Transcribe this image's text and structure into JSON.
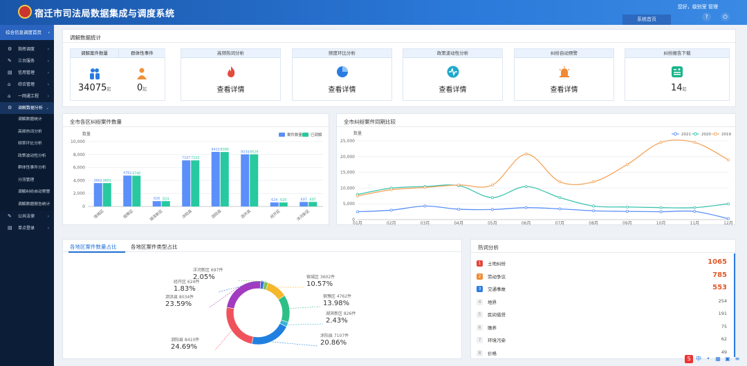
{
  "header": {
    "title": "宿迁市司法局数据集成与调度系统",
    "tab": "系统首页",
    "greeting": "您好，级别室 管理"
  },
  "sidebar": {
    "top": "综合信息调度首页",
    "items": [
      {
        "label": "指挥调度",
        "icon": "⚙"
      },
      {
        "label": "三台服务",
        "icon": "✎"
      },
      {
        "label": "信用管理",
        "icon": "▤"
      },
      {
        "label": "综合管理",
        "icon": "⌂"
      },
      {
        "label": "一网通工程",
        "icon": "⌂"
      },
      {
        "label": "调解数据分析",
        "icon": "⚙"
      }
    ],
    "subitems": [
      "调解数据统计",
      "高频热词分析",
      "频率环比分析",
      "政策波动性分析",
      "群体性事件分析",
      "分流管理",
      "调解纠纷自动预警",
      "调解数据报告统计"
    ],
    "items_after": [
      {
        "label": "公共法律",
        "icon": "✎"
      },
      {
        "label": "单点登录",
        "icon": "▤"
      }
    ]
  },
  "stats": {
    "title": "调解数据统计",
    "case_label": "调解案件数量",
    "case_value": "34075",
    "case_unit": "起",
    "group_label": "群体性事件",
    "group_value": "0",
    "group_unit": "起",
    "cards": [
      {
        "title": "高频热词分析",
        "link": "查看详情",
        "icon": "fire-icon",
        "color": "#e64a3b"
      },
      {
        "title": "频度环比分析",
        "link": "查看详情",
        "icon": "pie-icon",
        "color": "#2a7be0"
      },
      {
        "title": "政策波动性分析",
        "link": "查看详情",
        "icon": "pulse-icon",
        "color": "#1fa9c9"
      },
      {
        "title": "纠纷自动预警",
        "link": "查看详情",
        "icon": "alarm-icon",
        "color": "#f08a35"
      },
      {
        "title": "纠纷报告下载",
        "value": "14",
        "unit": "起",
        "icon": "report-icon",
        "color": "#19b58a"
      }
    ]
  },
  "bar_panel": {
    "title": "全市各区纠纷案件数量"
  },
  "line_panel": {
    "title": "全市纠纷案件同期比较"
  },
  "pie_panel": {
    "tabs": [
      "各地区案件数量占比",
      "各地区案件类型占比"
    ]
  },
  "hot_panel": {
    "title": "热词分析",
    "items": [
      {
        "rank": "1",
        "name": "土地纠纷",
        "count": "1065"
      },
      {
        "rank": "2",
        "name": "劳动争议",
        "count": "785"
      },
      {
        "rank": "3",
        "name": "交通事故",
        "count": "553"
      },
      {
        "rank": "4",
        "name": "地界",
        "count": "254"
      },
      {
        "rank": "5",
        "name": "民间借贷",
        "count": "191"
      },
      {
        "rank": "6",
        "name": "赡养",
        "count": "75"
      },
      {
        "rank": "7",
        "name": "环境污染",
        "count": "62"
      },
      {
        "rank": "8",
        "name": "价格",
        "count": "49"
      }
    ]
  },
  "chart_data": [
    {
      "type": "bar",
      "title": "全市各区纠纷案件数量",
      "ylabel": "数量",
      "ylim": [
        0,
        10000
      ],
      "yticks": [
        "0",
        "2,000",
        "4,000",
        "6,000",
        "8,000",
        "10,000"
      ],
      "legend_position": "top-right",
      "categories": [
        "宿城区",
        "宿豫区",
        "湖滨新区",
        "沭阳县",
        "泗阳县",
        "泗洪县",
        "经开区",
        "洋河新区"
      ],
      "series": [
        {
          "name": "案件数量",
          "color": "#5b8ff9",
          "values": [
            3602,
            4762,
            826,
            7107,
            8410,
            8034,
            624,
            697
          ]
        },
        {
          "name": "已调解",
          "color": "#27c9a0",
          "values": [
            3601,
            4740,
            824,
            7103,
            8390,
            8029,
            620,
            697
          ]
        }
      ]
    },
    {
      "type": "line",
      "title": "全市纠纷案件同期比较",
      "ylabel": "数量",
      "ylim": [
        0,
        25000
      ],
      "yticks": [
        "0",
        "5,000",
        "10,000",
        "15,000",
        "20,000",
        "25,000"
      ],
      "legend_position": "top-right",
      "categories": [
        "01月",
        "02月",
        "03月",
        "04月",
        "05月",
        "06月",
        "07月",
        "08月",
        "09月",
        "10月",
        "11月",
        "12月"
      ],
      "series": [
        {
          "name": "2021",
          "color": "#5b8ff9",
          "values": [
            2500,
            3000,
            4300,
            3300,
            3200,
            3800,
            3400,
            2800,
            2600,
            2500,
            2600,
            300
          ]
        },
        {
          "name": "2020",
          "color": "#3cc4b0",
          "values": [
            8000,
            10000,
            10500,
            10800,
            7000,
            10500,
            7000,
            4300,
            4000,
            3800,
            3800,
            5000
          ]
        },
        {
          "name": "2019",
          "color": "#f5a55b",
          "values": [
            7500,
            9500,
            10200,
            11000,
            11000,
            20800,
            12000,
            12000,
            17500,
            24500,
            24500,
            19000
          ]
        }
      ]
    },
    {
      "type": "pie",
      "title": "",
      "slices": [
        {
          "label": "宿城区",
          "count": "3602件",
          "percent": "10.57%",
          "value": 3602,
          "color": "#f5b72b"
        },
        {
          "label": "宿豫区",
          "count": "4762件",
          "percent": "13.98%",
          "value": 4762,
          "color": "#2fbf86"
        },
        {
          "label": "湖滨新区",
          "count": "826件",
          "percent": "2.43%",
          "value": 826,
          "color": "#3ab5d4"
        },
        {
          "label": "沭阳县",
          "count": "7107件",
          "percent": "20.86%",
          "value": 7107,
          "color": "#2080e0"
        },
        {
          "label": "泗阳县",
          "count": "8410件",
          "percent": "24.69%",
          "value": 8410,
          "color": "#f0525c"
        },
        {
          "label": "泗洪县",
          "count": "8034件",
          "percent": "23.59%",
          "value": 8034,
          "color": "#a23bbf"
        },
        {
          "label": "经开区",
          "count": "624件",
          "percent": "1.83%",
          "value": 624,
          "color": "#3d6fd6"
        },
        {
          "label": "洋河新区",
          "count": "697件",
          "percent": "2.05%",
          "value": 697,
          "color": "#7cc35c"
        }
      ]
    }
  ]
}
